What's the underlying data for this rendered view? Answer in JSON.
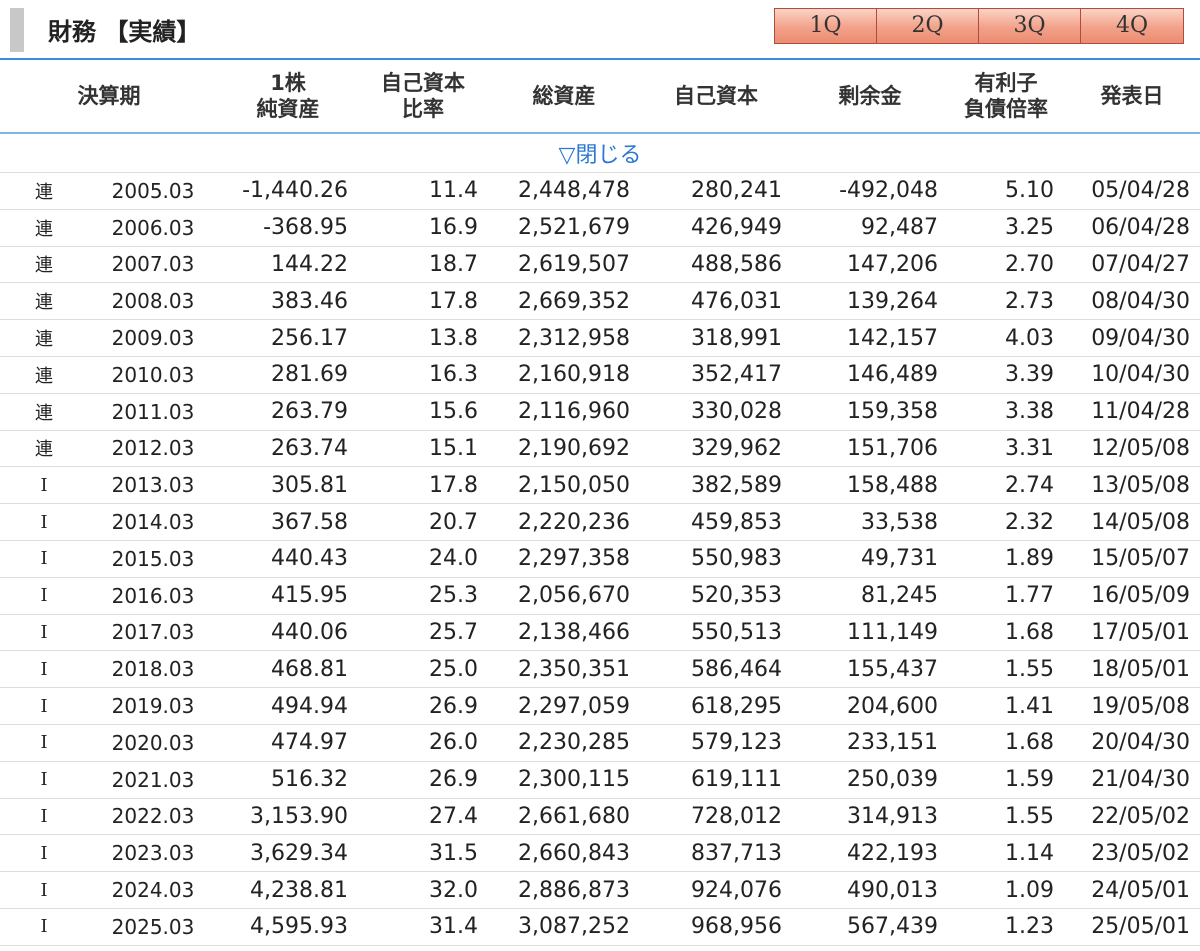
{
  "header": {
    "title": "財務 【実績】"
  },
  "quarter_tabs": [
    "1Q",
    "2Q",
    "3Q",
    "4Q"
  ],
  "columns": {
    "period": "決算期",
    "bps_line1": "1株",
    "bps_line2": "純資産",
    "equity_ratio_line1": "自己資本",
    "equity_ratio_line2": "比率",
    "total_assets": "総資産",
    "equity": "自己資本",
    "retained_earnings": "剰余金",
    "de_ratio_line1": "有利子",
    "de_ratio_line2": "負債倍率",
    "announce_date": "発表日"
  },
  "toggle": {
    "label": "▽閉じる"
  },
  "rows": [
    [
      "連",
      "2005.03",
      "-1,440.26",
      "11.4",
      "2,448,478",
      "280,241",
      "-492,048",
      "5.10",
      "05/04/28"
    ],
    [
      "連",
      "2006.03",
      "-368.95",
      "16.9",
      "2,521,679",
      "426,949",
      "92,487",
      "3.25",
      "06/04/28"
    ],
    [
      "連",
      "2007.03",
      "144.22",
      "18.7",
      "2,619,507",
      "488,586",
      "147,206",
      "2.70",
      "07/04/27"
    ],
    [
      "連",
      "2008.03",
      "383.46",
      "17.8",
      "2,669,352",
      "476,031",
      "139,264",
      "2.73",
      "08/04/30"
    ],
    [
      "連",
      "2009.03",
      "256.17",
      "13.8",
      "2,312,958",
      "318,991",
      "142,157",
      "4.03",
      "09/04/30"
    ],
    [
      "連",
      "2010.03",
      "281.69",
      "16.3",
      "2,160,918",
      "352,417",
      "146,489",
      "3.39",
      "10/04/30"
    ],
    [
      "連",
      "2011.03",
      "263.79",
      "15.6",
      "2,116,960",
      "330,028",
      "159,358",
      "3.38",
      "11/04/28"
    ],
    [
      "連",
      "2012.03",
      "263.74",
      "15.1",
      "2,190,692",
      "329,962",
      "151,706",
      "3.31",
      "12/05/08"
    ],
    [
      "I",
      "2013.03",
      "305.81",
      "17.8",
      "2,150,050",
      "382,589",
      "158,488",
      "2.74",
      "13/05/08"
    ],
    [
      "I",
      "2014.03",
      "367.58",
      "20.7",
      "2,220,236",
      "459,853",
      "33,538",
      "2.32",
      "14/05/08"
    ],
    [
      "I",
      "2015.03",
      "440.43",
      "24.0",
      "2,297,358",
      "550,983",
      "49,731",
      "1.89",
      "15/05/07"
    ],
    [
      "I",
      "2016.03",
      "415.95",
      "25.3",
      "2,056,670",
      "520,353",
      "81,245",
      "1.77",
      "16/05/09"
    ],
    [
      "I",
      "2017.03",
      "440.06",
      "25.7",
      "2,138,466",
      "550,513",
      "111,149",
      "1.68",
      "17/05/01"
    ],
    [
      "I",
      "2018.03",
      "468.81",
      "25.0",
      "2,350,351",
      "586,464",
      "155,437",
      "1.55",
      "18/05/01"
    ],
    [
      "I",
      "2019.03",
      "494.94",
      "26.9",
      "2,297,059",
      "618,295",
      "204,600",
      "1.41",
      "19/05/08"
    ],
    [
      "I",
      "2020.03",
      "474.97",
      "26.0",
      "2,230,285",
      "579,123",
      "233,151",
      "1.68",
      "20/04/30"
    ],
    [
      "I",
      "2021.03",
      "516.32",
      "26.9",
      "2,300,115",
      "619,111",
      "250,039",
      "1.59",
      "21/04/30"
    ],
    [
      "I",
      "2022.03",
      "3,153.90",
      "27.4",
      "2,661,680",
      "728,012",
      "314,913",
      "1.55",
      "22/05/02"
    ],
    [
      "I",
      "2023.03",
      "3,629.34",
      "31.5",
      "2,660,843",
      "837,713",
      "422,193",
      "1.14",
      "23/05/02"
    ],
    [
      "I",
      "2024.03",
      "4,238.81",
      "32.0",
      "2,886,873",
      "924,076",
      "490,013",
      "1.09",
      "24/05/01"
    ],
    [
      "I",
      "2025.03",
      "4,595.93",
      "31.4",
      "3,087,252",
      "968,956",
      "567,439",
      "1.23",
      "25/05/01"
    ]
  ]
}
